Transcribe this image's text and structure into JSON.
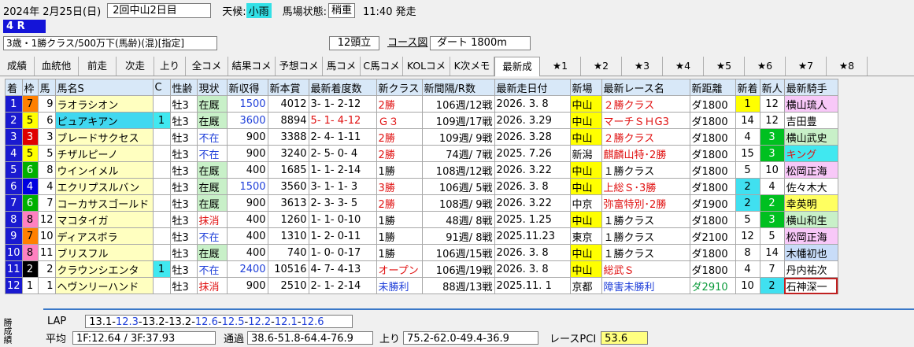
{
  "header": {
    "date": "2024年  2月25日(日)",
    "meet": "2回中山2日目",
    "weather_label": "天候:",
    "weather": "小雨",
    "track_label": "馬場状態:",
    "track": "稍重",
    "start_time": "11:40 発走"
  },
  "race": {
    "number": "4 R",
    "class": "3歳・1勝クラス/500万下(馬齢)(混)[指定]",
    "heads": "12頭立",
    "course_link": "コース図",
    "course": "ダート  1800m"
  },
  "tabs": [
    "成績",
    "血統他",
    "前走",
    "次走",
    "上り",
    "全コメ",
    "結果コメ",
    "予想コメ",
    "馬コメ",
    "C馬コメ",
    "KOLコメ",
    "K次メモ",
    "最新成",
    "★1",
    "★2",
    "★3",
    "★4",
    "★5",
    "★6",
    "★7",
    "★8"
  ],
  "active_tab": "最新成",
  "columns": [
    "着",
    "枠",
    "馬",
    "馬名S",
    "C",
    "性齢",
    "現状",
    "新収得",
    "新本賞",
    "最新着度数",
    "新クラス",
    "新間隔/R数",
    "最新走日付",
    "新場",
    "最新レース名",
    "新距離",
    "新着",
    "新人",
    "最新騎手"
  ],
  "frame_colors": {
    "1": "#ffffff",
    "2": "#000000",
    "3": "#e00000",
    "4": "#0000e0",
    "5": "#ffff00",
    "6": "#00b000",
    "7": "#ff8000",
    "8": "#ff80c0"
  },
  "rows": [
    {
      "rank": "1",
      "frame": "7",
      "num": "9",
      "name": "ラオラシオン",
      "c": "",
      "sex": "牡3",
      "status": "在厩",
      "earn": "1500",
      "prize": "4012",
      "record": "3- 1- 2-12",
      "cls": "2勝",
      "interval": "106週/12戦",
      "date": "2026. 3. 8",
      "venue": "中山",
      "race": "２勝クラス",
      "dist": "ダ1800",
      "fin": "1",
      "pop": "12",
      "jockey": "横山琉人"
    },
    {
      "rank": "2",
      "frame": "5",
      "num": "6",
      "name": "ピュアキアン",
      "c": "1",
      "sex": "牡3",
      "status": "在厩",
      "earn": "3600",
      "prize": "8894",
      "record": "5- 1- 4-12",
      "cls": "Ｇ３",
      "interval": "109週/17戦",
      "date": "2026. 3.29",
      "venue": "中山",
      "race": "マーチＳＨG3",
      "dist": "ダ1800",
      "fin": "14",
      "pop": "12",
      "jockey": "吉田豊"
    },
    {
      "rank": "3",
      "frame": "3",
      "num": "3",
      "name": "ブレードサクセス",
      "c": "",
      "sex": "牡3",
      "status": "不在",
      "earn": "900",
      "prize": "3388",
      "record": "2- 4- 1-11",
      "cls": "2勝",
      "interval": "109週/ 9戦",
      "date": "2026. 3.28",
      "venue": "中山",
      "race": "２勝クラス",
      "dist": "ダ1800",
      "fin": "4",
      "pop": "3",
      "jockey": "横山武史"
    },
    {
      "rank": "4",
      "frame": "5",
      "num": "5",
      "name": "チザルピーノ",
      "c": "",
      "sex": "牡3",
      "status": "不在",
      "earn": "900",
      "prize": "3240",
      "record": "2- 5- 0- 4",
      "cls": "2勝",
      "interval": "74週/ 7戦",
      "date": "2025. 7.26",
      "venue": "新潟",
      "race": "麒麟山特･2勝",
      "dist": "ダ1800",
      "fin": "15",
      "pop": "3",
      "jockey": "キング"
    },
    {
      "rank": "5",
      "frame": "6",
      "num": "8",
      "name": "ウインイメル",
      "c": "",
      "sex": "牡3",
      "status": "在厩",
      "earn": "400",
      "prize": "1685",
      "record": "1- 1- 2-14",
      "cls": "1勝",
      "interval": "108週/12戦",
      "date": "2026. 3.22",
      "venue": "中山",
      "race": "１勝クラス",
      "dist": "ダ1800",
      "fin": "5",
      "pop": "10",
      "jockey": "松岡正海"
    },
    {
      "rank": "6",
      "frame": "4",
      "num": "4",
      "name": "エクリプスルバン",
      "c": "",
      "sex": "牡3",
      "status": "在厩",
      "earn": "1500",
      "prize": "3560",
      "record": "3- 1- 1- 3",
      "cls": "3勝",
      "interval": "106週/ 5戦",
      "date": "2026. 3. 8",
      "venue": "中山",
      "race": "上総Ｓ･3勝",
      "dist": "ダ1800",
      "fin": "2",
      "pop": "4",
      "jockey": "佐々木大"
    },
    {
      "rank": "7",
      "frame": "6",
      "num": "7",
      "name": "コーカサスゴールド",
      "c": "",
      "sex": "牡3",
      "status": "在厩",
      "earn": "900",
      "prize": "3613",
      "record": "2- 3- 3- 5",
      "cls": "2勝",
      "interval": "108週/ 9戦",
      "date": "2026. 3.22",
      "venue": "中京",
      "race": "弥富特別･2勝",
      "dist": "ダ1900",
      "fin": "2",
      "pop": "2",
      "jockey": "幸英明"
    },
    {
      "rank": "8",
      "frame": "8",
      "num": "12",
      "name": "マコタイガ",
      "c": "",
      "sex": "牡3",
      "status": "抹消",
      "earn": "400",
      "prize": "1260",
      "record": "1- 1- 0-10",
      "cls": "1勝",
      "interval": "48週/ 8戦",
      "date": "2025. 1.25",
      "venue": "中山",
      "race": "１勝クラス",
      "dist": "ダ1800",
      "fin": "5",
      "pop": "3",
      "jockey": "横山和生"
    },
    {
      "rank": "9",
      "frame": "7",
      "num": "10",
      "name": "ディアスボラ",
      "c": "",
      "sex": "牡3",
      "status": "不在",
      "earn": "400",
      "prize": "1310",
      "record": "1- 2- 0-11",
      "cls": "1勝",
      "interval": "91週/ 8戦",
      "date": "2025.11.23",
      "venue": "東京",
      "race": "１勝クラス",
      "dist": "ダ2100",
      "fin": "12",
      "pop": "5",
      "jockey": "松岡正海"
    },
    {
      "rank": "10",
      "frame": "8",
      "num": "11",
      "name": "ブリスフル",
      "c": "",
      "sex": "牡3",
      "status": "在厩",
      "earn": "400",
      "prize": "740",
      "record": "1- 0- 0-17",
      "cls": "1勝",
      "interval": "106週/15戦",
      "date": "2026. 3. 8",
      "venue": "中山",
      "race": "１勝クラス",
      "dist": "ダ1800",
      "fin": "8",
      "pop": "14",
      "jockey": "木幡初也"
    },
    {
      "rank": "11",
      "frame": "2",
      "num": "2",
      "name": "クラウンシエンタ",
      "c": "1",
      "sex": "牡3",
      "status": "不在",
      "earn": "2400",
      "prize": "10516",
      "record": "4- 7- 4-13",
      "cls": "オープン",
      "interval": "106週/19戦",
      "date": "2026. 3. 8",
      "venue": "中山",
      "race": "総武Ｓ",
      "dist": "ダ1800",
      "fin": "4",
      "pop": "7",
      "jockey": "丹内祐次"
    },
    {
      "rank": "12",
      "frame": "1",
      "num": "1",
      "name": "ヘヴンリーハンド",
      "c": "",
      "sex": "牡3",
      "status": "抹消",
      "earn": "900",
      "prize": "2510",
      "record": "2- 1- 2-14",
      "cls": "未勝利",
      "interval": "88週/13戦",
      "date": "2025.11. 1",
      "venue": "京都",
      "race": "障害未勝利",
      "dist": "ダ2910",
      "fin": "10",
      "pop": "2",
      "jockey": "石神深一"
    }
  ],
  "footer": {
    "side_label": "勝成績",
    "lap_label": "LAP",
    "lap": [
      "13.1",
      "12.3",
      "13.2",
      "13.2",
      "12.6",
      "12.5",
      "12.2",
      "12.1",
      "12.6"
    ],
    "avg_label": "平均",
    "avg": "1F:12.64 / 3F:37.93",
    "pass_label": "通過",
    "pass": "38.6-51.8-64.4-76.9",
    "agari_label": "上り",
    "agari": "75.2-62.0-49.4-36.9",
    "pci_label": "レースPCI",
    "pci": "53.6"
  }
}
